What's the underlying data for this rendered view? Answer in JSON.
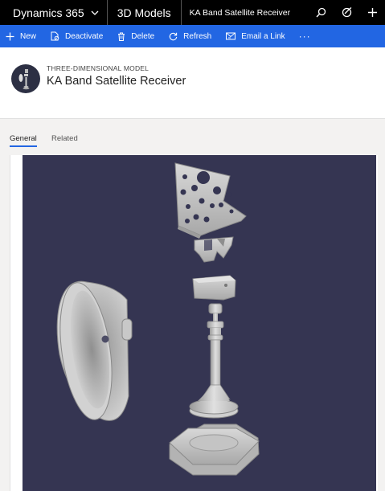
{
  "nav": {
    "app_name": "Dynamics 365",
    "area_name": "3D Models",
    "record_breadcrumb": "KA Band Satellite Receiver",
    "icons": [
      "search-icon",
      "assistant-icon",
      "plus-icon"
    ]
  },
  "commands": [
    {
      "label": "New",
      "icon": "plus-icon"
    },
    {
      "label": "Deactivate",
      "icon": "deactivate-icon"
    },
    {
      "label": "Delete",
      "icon": "trash-icon"
    },
    {
      "label": "Refresh",
      "icon": "refresh-icon"
    },
    {
      "label": "Email a Link",
      "icon": "email-link-icon"
    },
    {
      "label": "···",
      "icon": "more-icon"
    }
  ],
  "record": {
    "entity_label": "THREE-DIMENSIONAL MODEL",
    "name": "KA Band Satellite Receiver"
  },
  "tabs": [
    {
      "label": "General",
      "active": true
    },
    {
      "label": "Related",
      "active": false
    }
  ],
  "colors": {
    "topbar": "#000000",
    "commandbar": "#2266e3",
    "viewer_background": "#353552",
    "model_part": "#c8c8c8"
  }
}
